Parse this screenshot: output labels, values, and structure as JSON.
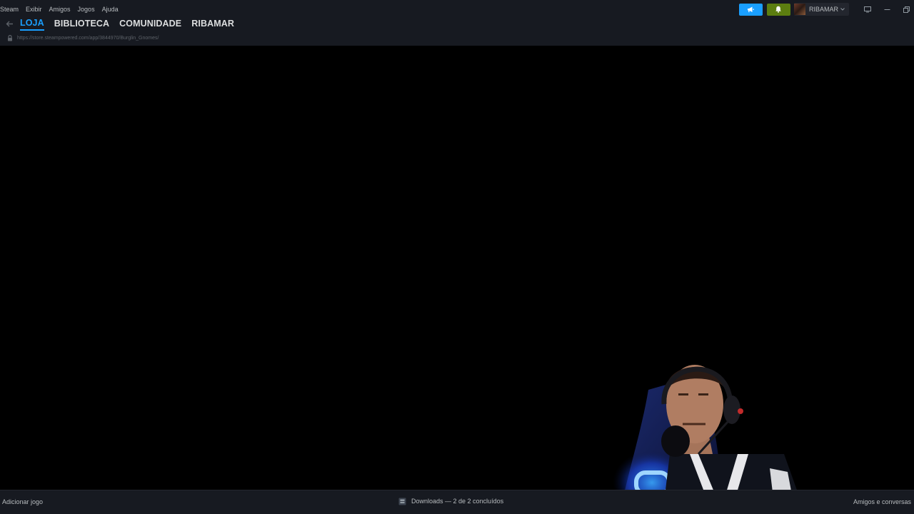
{
  "menu": {
    "items": [
      "Steam",
      "Exibir",
      "Amigos",
      "Jogos",
      "Ajuda"
    ]
  },
  "user": {
    "name": "RIBAMAR"
  },
  "nav": {
    "tabs": [
      {
        "label": "LOJA",
        "active": true
      },
      {
        "label": "BIBLIOTECA",
        "active": false
      },
      {
        "label": "COMUNIDADE",
        "active": false
      },
      {
        "label": "RIBAMAR",
        "active": false
      }
    ]
  },
  "url": {
    "text": "https://store.steampowered.com/app/3844970/Burglin_Gnomes/"
  },
  "bottom": {
    "add_game": "Adicionar jogo",
    "downloads": "Downloads — 2 de 2 concluídos",
    "friends": "Amigos e conversas"
  },
  "colors": {
    "accent": "#1a9fff",
    "notification": "#5c7e10",
    "bar_bg": "#171a21",
    "content_bg": "#000000"
  },
  "icons": {
    "announce": "megaphone-icon",
    "notification": "bell-icon",
    "back": "arrow-left-icon",
    "lock": "lock-icon",
    "downloads": "download-icon"
  }
}
